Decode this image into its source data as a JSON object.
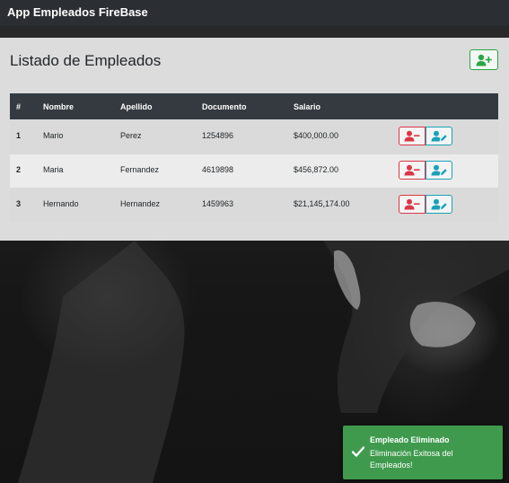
{
  "app": {
    "brand": "App Empleados FireBase"
  },
  "page": {
    "title": "Listado de Empleados"
  },
  "table": {
    "headers": [
      "#",
      "Nombre",
      "Apellido",
      "Documento",
      "Salario"
    ],
    "rows": [
      {
        "num": "1",
        "nombre": "Mario",
        "apellido": "Perez",
        "documento": "1254896",
        "salario": "$400,000.00"
      },
      {
        "num": "2",
        "nombre": "Maria",
        "apellido": "Fernandez",
        "documento": "4619898",
        "salario": "$456,872.00"
      },
      {
        "num": "3",
        "nombre": "Hernando",
        "apellido": "Hernandez",
        "documento": "1459963",
        "salario": "$21,145,174.00"
      }
    ]
  },
  "toast": {
    "title": "Empleado Eliminado",
    "message": "Eliminación Exitosa del Empleados!"
  },
  "icons": {
    "add": "user-plus-icon",
    "delete": "user-minus-icon",
    "edit": "user-edit-icon",
    "toast": "check-icon"
  },
  "colors": {
    "navbar": "#2b2e33",
    "table_header": "#343a40",
    "success": "#28a745",
    "danger": "#dc3545",
    "info": "#17a2b8",
    "toast_bg": "#3f9a4d"
  }
}
